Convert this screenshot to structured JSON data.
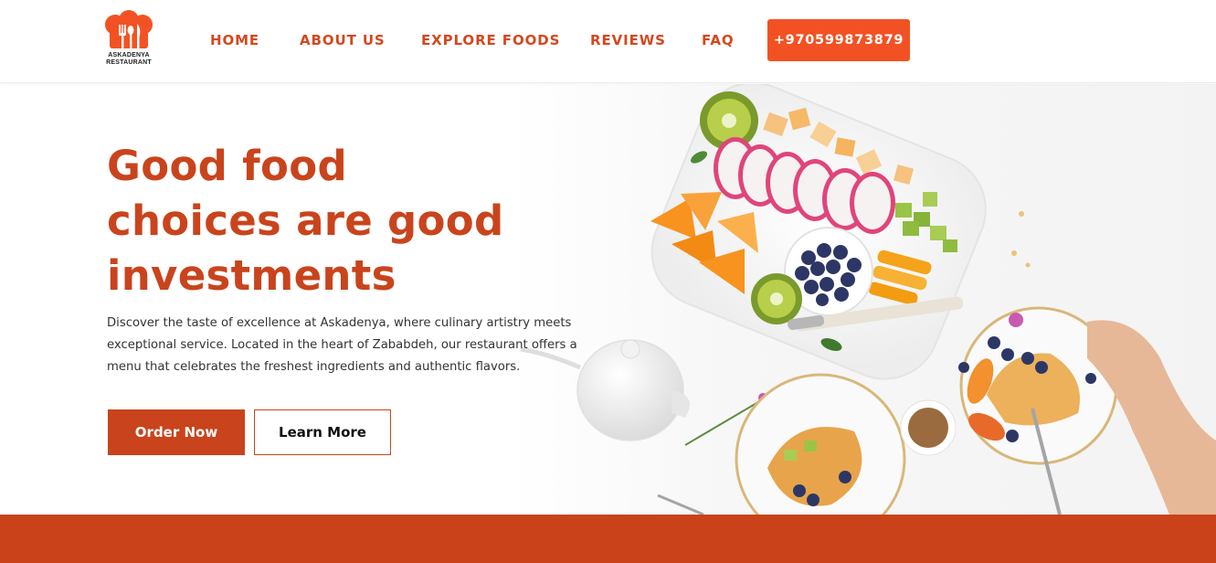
{
  "brand": {
    "logo_line1": "ASKADENYA",
    "logo_line2": "RESTAURANT",
    "logo_icon": "chef-hat-cutlery-icon",
    "accent": "#d4481e"
  },
  "nav": {
    "items": [
      {
        "label": "HOME"
      },
      {
        "label": "ABOUT US"
      },
      {
        "label": "EXPLORE FOODS"
      },
      {
        "label": "REVIEWS"
      },
      {
        "label": "FAQ"
      }
    ],
    "phone": "+970599873879",
    "phone_color": "#f25223"
  },
  "hero": {
    "headline_lines": [
      "Good food",
      "choices are good",
      "investments"
    ],
    "description": "Discover the taste of excellence at Askadenya, where culinary artistry meets exceptional service. Located in the heart of Zababdeh, our restaurant offers a menu that celebrates the freshest ingredients and authentic flavors.",
    "primary_button": "Order Now",
    "secondary_button": "Learn More",
    "image": "fruit-platter-and-pancakes-photo",
    "headline_color": "#c9441c"
  },
  "band_color": "#c9421a"
}
